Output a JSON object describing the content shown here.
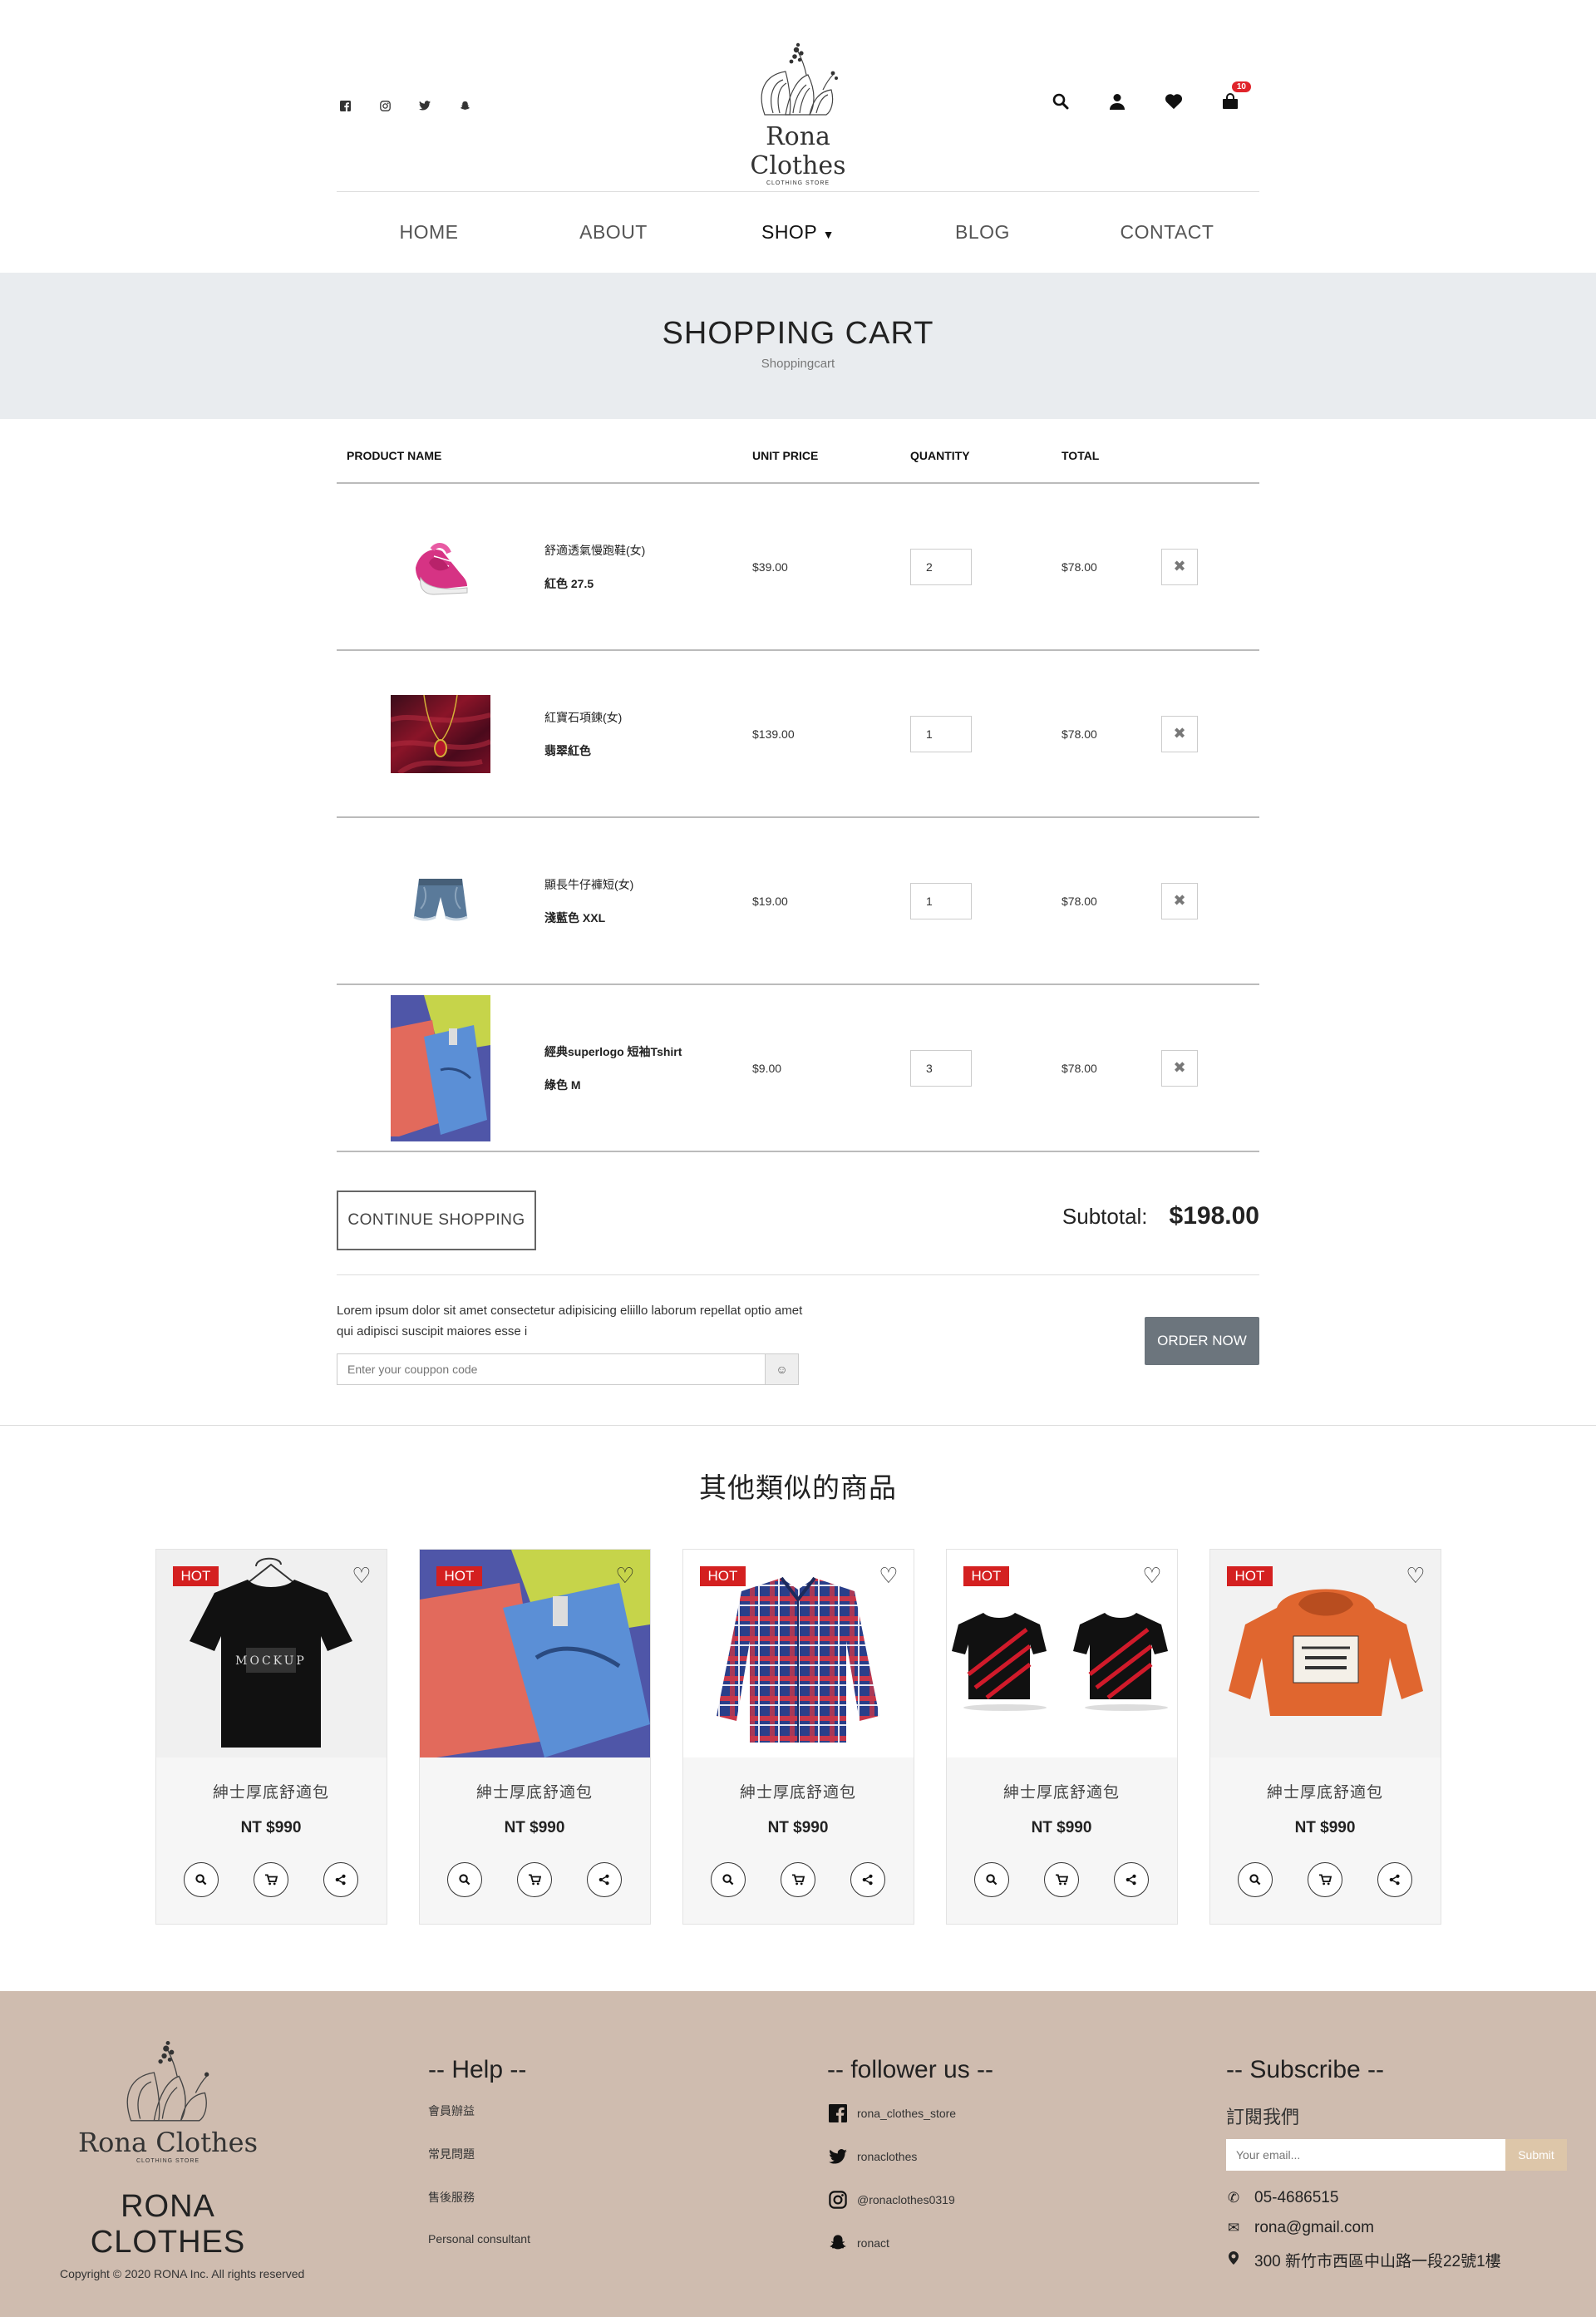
{
  "header": {
    "brand": "Rona Clothes",
    "brand_sub": "CLOTHING STORE",
    "social_icons": [
      "facebook-icon",
      "instagram-icon",
      "twitter-icon",
      "snapchat-icon"
    ],
    "cart_count": "10"
  },
  "nav": {
    "items": [
      {
        "label": "HOME"
      },
      {
        "label": "ABOUT"
      },
      {
        "label": "SHOP"
      },
      {
        "label": "BLOG"
      },
      {
        "label": "CONTACT"
      }
    ]
  },
  "banner": {
    "title": "SHOPPING CART",
    "breadcrumb": "Shoppingcart"
  },
  "cart": {
    "headers": {
      "product_name": "PRODUCT NAME",
      "unit_price": "UNIT PRICE",
      "quantity": "QUANTITY",
      "total": "TOTAL"
    },
    "rows": [
      {
        "name": "舒適透氣慢跑鞋(女)",
        "variant": "紅色 27.5",
        "price": "$39.00",
        "qty": "2",
        "total": "$78.00"
      },
      {
        "name": "紅寶石項鍊(女)",
        "variant": "翡翠紅色",
        "price": "$139.00",
        "qty": "1",
        "total": "$78.00"
      },
      {
        "name": "顯長牛仔褲短(女)",
        "variant": "淺藍色 XXL",
        "price": "$19.00",
        "qty": "1",
        "total": "$78.00"
      },
      {
        "name": "經典superlogo 短袖Tshirt",
        "variant": "綠色 M",
        "price": "$9.00",
        "qty": "3",
        "total": "$78.00"
      }
    ],
    "continue_label": "CONTINUE SHOPPING",
    "subtotal_label": "Subtotal:",
    "subtotal_value": "$198.00",
    "note": "Lorem ipsum dolor sit amet consectetur adipisicing eliillo laborum repellat optio amet qui adipisci suscipit maiores esse i",
    "coupon_placeholder": "Enter your couppon code",
    "order_label": "ORDER NOW"
  },
  "similar": {
    "title": "其他類似的商品",
    "hot_label": "HOT",
    "items": [
      {
        "title": "紳士厚底舒適包",
        "price": "NT $990"
      },
      {
        "title": "紳士厚底舒適包",
        "price": "NT $990"
      },
      {
        "title": "紳士厚底舒適包",
        "price": "NT $990"
      },
      {
        "title": "紳士厚底舒適包",
        "price": "NT $990"
      },
      {
        "title": "紳士厚底舒適包",
        "price": "NT $990"
      }
    ]
  },
  "footer": {
    "brand": "Rona Clothes",
    "brand_sub": "CLOTHING STORE",
    "big_name": "RONA CLOTHES",
    "copyright": "Copyright © 2020 RONA Inc. All rights reserved",
    "help": {
      "title": "-- Help --",
      "links": [
        "會員辦益",
        "常見問題",
        "售後服務",
        "Personal consultant"
      ]
    },
    "follow": {
      "title": "-- follower us --",
      "links": [
        "rona_clothes_store",
        "ronaclothes",
        "@ronaclothes0319",
        "ronact"
      ]
    },
    "subscribe": {
      "title": "-- Subscribe --",
      "label": "訂閱我們",
      "placeholder": "Your email...",
      "button": "Submit",
      "phone": "05-4686515",
      "email": "rona@gmail.com",
      "address": "300 新竹市西區中山路一段22號1樓"
    }
  }
}
